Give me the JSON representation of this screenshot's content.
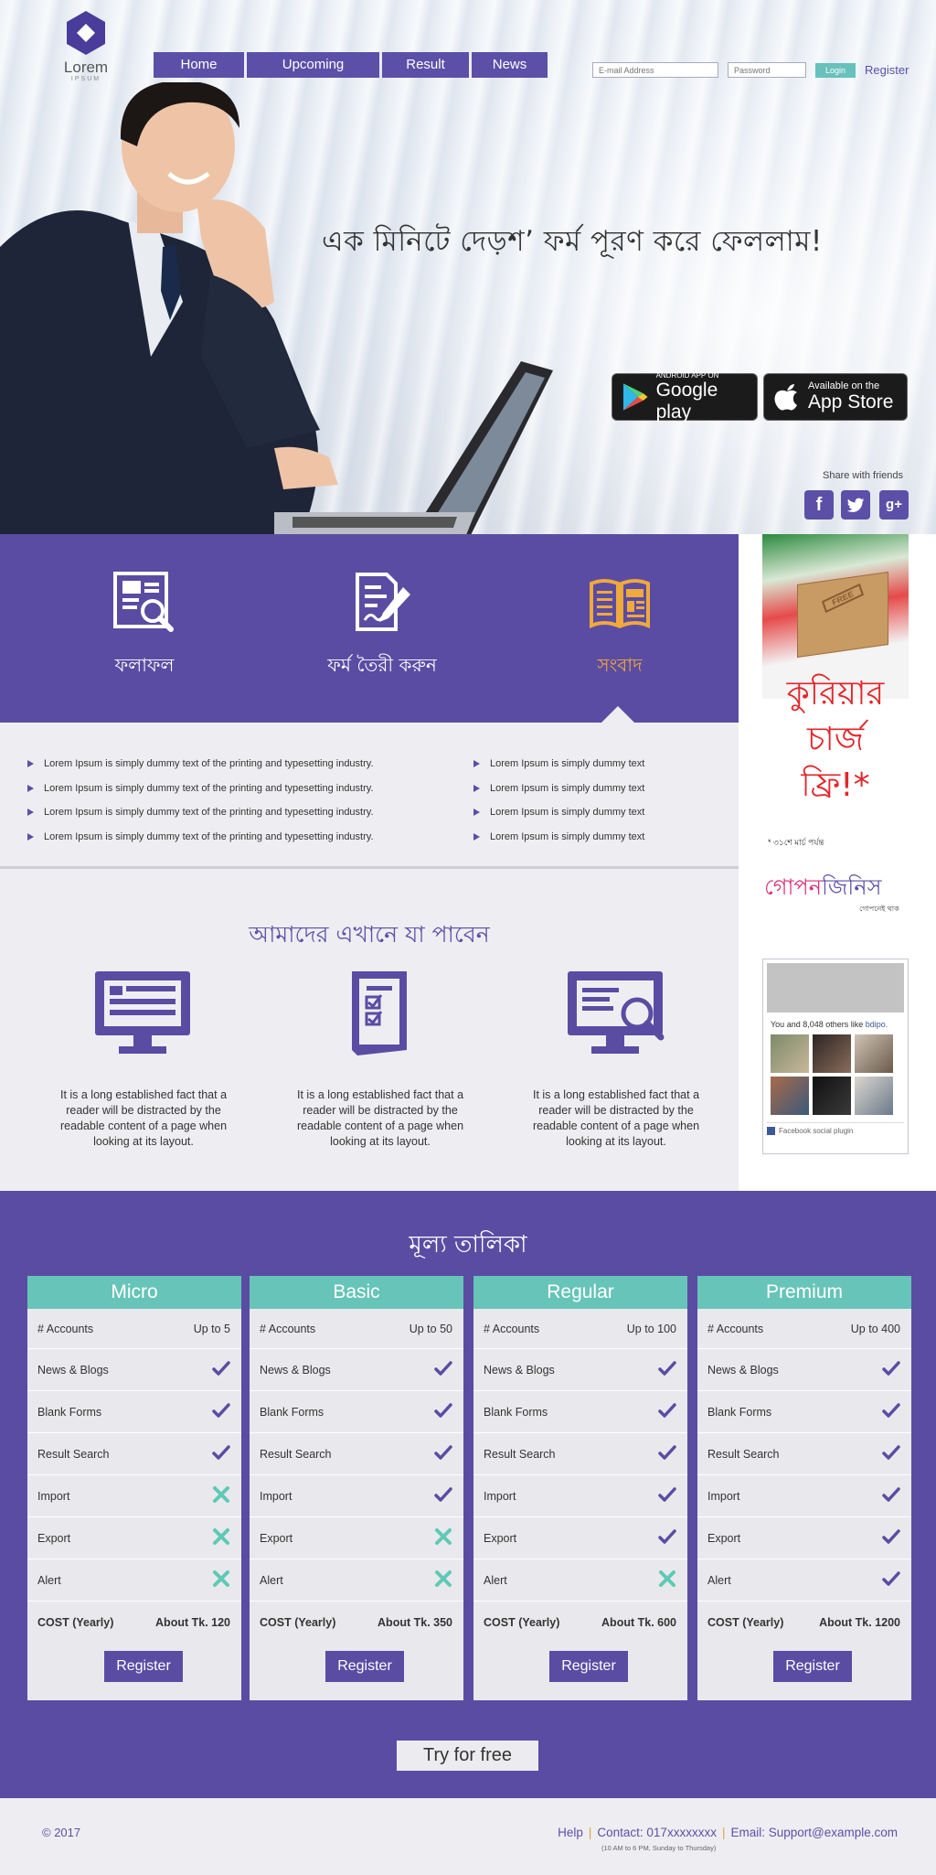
{
  "logo": {
    "name": "Lorem",
    "sub": "IPSUM"
  },
  "nav": {
    "items": [
      "Home",
      "Upcoming",
      "Result",
      "News"
    ]
  },
  "login": {
    "email_placeholder": "E-mail Address",
    "password_placeholder": "Password",
    "login_label": "Login",
    "register_label": "Register"
  },
  "hero": {
    "headline": "এক মিনিটে দেড়শ’ ফর্ম পূরণ করে ফেললাম!"
  },
  "stores": {
    "google": {
      "small": "ANDROID APP ON",
      "big": "Google play"
    },
    "apple": {
      "small": "Available on the",
      "big": "App Store"
    }
  },
  "share": {
    "label": "Share with friends",
    "icons": [
      "facebook-icon",
      "twitter-icon",
      "google-plus-icon"
    ],
    "fb": "f",
    "gplus": "g+"
  },
  "features": [
    {
      "label": "ফলাফল",
      "icon": "result-search-icon"
    },
    {
      "label": "ফর্ম তৈরী করুন",
      "icon": "form-edit-icon"
    },
    {
      "label": "সংবাদ",
      "icon": "news-book-icon"
    }
  ],
  "news": {
    "left": [
      "Lorem Ipsum is simply dummy text of the printing and typesetting industry.",
      "Lorem Ipsum is simply dummy text of the printing and typesetting industry.",
      "Lorem Ipsum is simply dummy text of the printing and typesetting industry.",
      "Lorem Ipsum is simply dummy text of the printing and typesetting industry."
    ],
    "right": [
      "Lorem Ipsum is simply dummy text",
      "Lorem Ipsum is simply dummy text",
      "Lorem Ipsum is simply dummy text",
      "Lorem Ipsum is simply dummy text"
    ]
  },
  "sidebar": {
    "ad": {
      "box": "FREE",
      "line1": "কুরিয়ার",
      "line2": "চার্জ",
      "line3": "ফ্রি!*",
      "note": "* ৩১শে মার্চ পর্যন্ত"
    },
    "brand": {
      "name_a": "গোপন",
      "name_b": "জিনিস",
      "tag": "গোপনেই থাক"
    },
    "facebook": {
      "likes_prefix": "You and 8,048 others like",
      "page": "bdipo.",
      "plugin": "Facebook social plugin"
    }
  },
  "offer": {
    "title": "আমাদের এখানে যা পাবেন",
    "items": [
      {
        "icon": "monitor-icon",
        "text": "It is a long established fact that a reader will be distracted by the readable content of a page when looking at its layout."
      },
      {
        "icon": "checklist-document-icon",
        "text": "It is a long established fact that a reader will be distracted by the readable content of a page when looking at its layout."
      },
      {
        "icon": "monitor-search-icon",
        "text": "It is a long established fact that a reader will be distracted by the readable content of a page when looking at its layout."
      }
    ]
  },
  "pricing": {
    "title": "মূল্য তালিকা",
    "row_labels": [
      "# Accounts",
      "News & Blogs",
      "Blank Forms",
      "Result Search",
      "Import",
      "Export",
      "Alert",
      "COST (Yearly)"
    ],
    "plans": [
      {
        "name": "Micro",
        "accounts": "Up to 5",
        "features": [
          true,
          true,
          true,
          false,
          false,
          false
        ],
        "cost": "About Tk. 120",
        "register": "Register"
      },
      {
        "name": "Basic",
        "accounts": "Up to 50",
        "features": [
          true,
          true,
          true,
          true,
          false,
          false
        ],
        "cost": "About Tk. 350",
        "register": "Register"
      },
      {
        "name": "Regular",
        "accounts": "Up to 100",
        "features": [
          true,
          true,
          true,
          true,
          true,
          false
        ],
        "cost": "About Tk. 600",
        "register": "Register"
      },
      {
        "name": "Premium",
        "accounts": "Up to 400",
        "features": [
          true,
          true,
          true,
          true,
          true,
          true
        ],
        "cost": "About Tk. 1200",
        "register": "Register"
      }
    ],
    "try_label": "Try for free"
  },
  "footer": {
    "copyright": "© 2017",
    "help": "Help",
    "contact": "Contact: 017xxxxxxxx",
    "email": "Email: Support@example.com",
    "hours": "(10 AM to 6 PM, Sunday to Thursday)"
  },
  "colors": {
    "primary": "#5b4ca3",
    "accent": "#67c4b8",
    "orange": "#f0a93b",
    "cross": "#5ec9b5"
  }
}
